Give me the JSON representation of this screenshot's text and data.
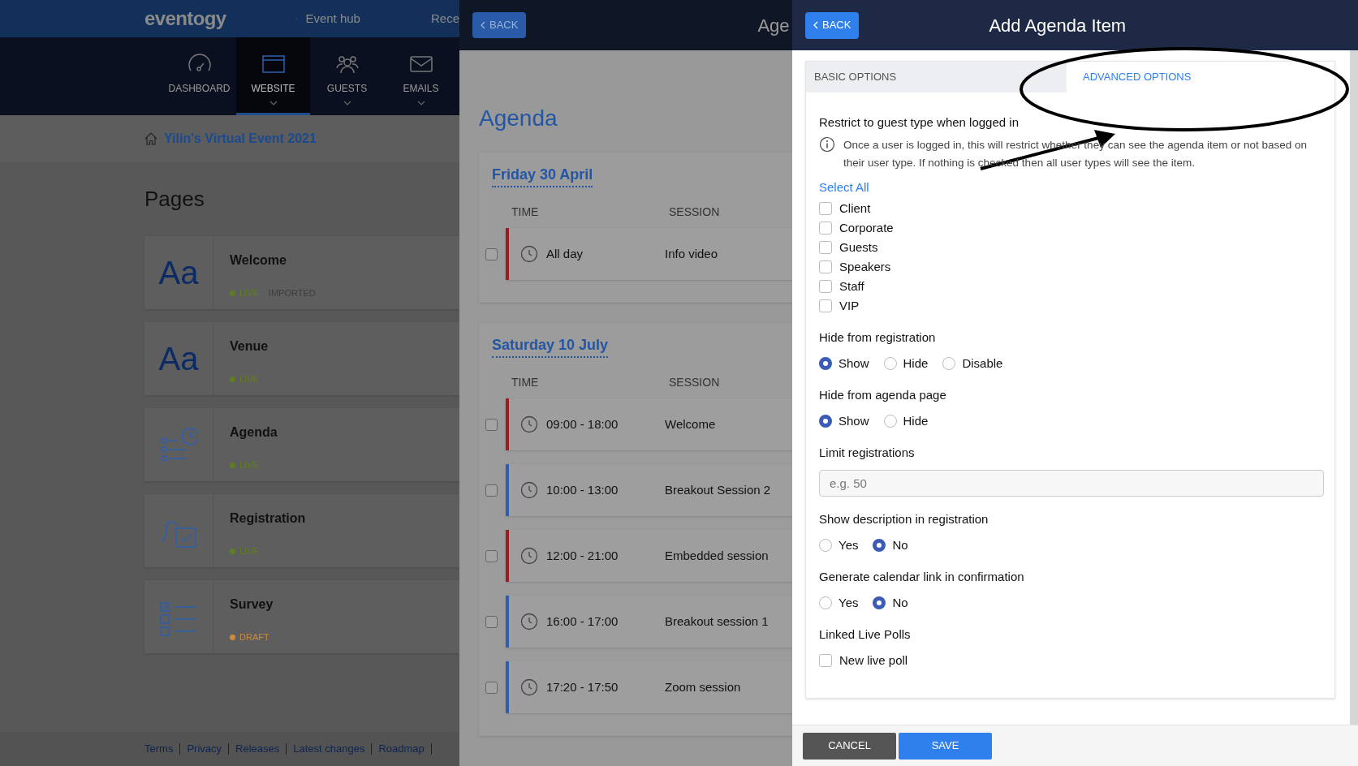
{
  "app_panel": {
    "logo": "eventogy",
    "back_link": "Event hub",
    "nav_cut": "Rece",
    "nav": [
      {
        "label": "DASHBOARD",
        "selected": false,
        "caret": false
      },
      {
        "label": "WEBSITE",
        "selected": true,
        "caret": true
      },
      {
        "label": "GUESTS",
        "selected": false,
        "caret": true
      },
      {
        "label": "EMAILS",
        "selected": false,
        "caret": true
      }
    ],
    "breadcrumb": "Yilin's Virtual Event 2021",
    "title": "Pages",
    "pages": [
      {
        "name": "Welcome",
        "kind": "text",
        "icon_text": "Aa",
        "statuses": [
          {
            "label": "LIVE",
            "color": "#5f7f1f"
          },
          {
            "label": "IMPORTED"
          }
        ]
      },
      {
        "name": "Venue",
        "kind": "text",
        "icon_text": "Aa",
        "statuses": [
          {
            "label": "LIVE",
            "color": "#5f7f1f"
          }
        ]
      },
      {
        "name": "Agenda",
        "kind": "agenda",
        "statuses": [
          {
            "label": "LIVE",
            "color": "#5f7f1f"
          }
        ]
      },
      {
        "name": "Registration",
        "kind": "registration",
        "statuses": [
          {
            "label": "LIVE",
            "color": "#5f7f1f"
          }
        ]
      },
      {
        "name": "Survey",
        "kind": "survey",
        "statuses": [
          {
            "label": "DRAFT",
            "color": "#d08a3a"
          }
        ]
      }
    ],
    "footer_links": [
      "Terms",
      "Privacy",
      "Releases",
      "Latest changes",
      "Roadmap"
    ]
  },
  "agenda_panel": {
    "back": "BACK",
    "header_title": "Age",
    "title": "Agenda",
    "days": [
      {
        "date": "Friday 30 April",
        "columns": [
          "TIME",
          "SESSION"
        ],
        "rows": [
          {
            "time": "All day",
            "session": "Info video",
            "checked": false,
            "color": "#9b1b22"
          }
        ]
      },
      {
        "date": "Saturday 10 July",
        "columns": [
          "TIME",
          "SESSION"
        ],
        "rows": [
          {
            "time": "09:00 - 18:00",
            "session": "Welcome",
            "checked": false,
            "color": "#9b1b22"
          },
          {
            "time": "10:00 - 13:00",
            "session": "Breakout Session 2",
            "checked": false,
            "color": "#2d5fae"
          },
          {
            "time": "12:00 - 21:00",
            "session": "Embedded session",
            "checked": false,
            "color": "#9b1b22"
          },
          {
            "time": "16:00 - 17:00",
            "session": "Breakout session 1",
            "checked": false,
            "color": "#2d5fae"
          },
          {
            "time": "17:20 - 17:50",
            "session": "Zoom session",
            "checked": false,
            "color": "#2d5fae"
          }
        ]
      }
    ]
  },
  "editor": {
    "back": "BACK",
    "title": "Add Agenda Item",
    "tabs": [
      {
        "label": "BASIC OPTIONS",
        "selected": false
      },
      {
        "label": "ADVANCED OPTIONS",
        "selected": true
      }
    ],
    "sections": [
      {
        "kind": "checkboxes",
        "heading": "Restrict to guest type when logged in",
        "info": "Once a user is logged in, this will restrict whether they can see the agenda item or not based on their user type. If nothing is checked then all user types will see the item.",
        "select_all": "Select All",
        "options": [
          {
            "label": "Client",
            "checked": false
          },
          {
            "label": "Corporate",
            "checked": false
          },
          {
            "label": "Guests",
            "checked": false
          },
          {
            "label": "Speakers",
            "checked": false
          },
          {
            "label": "Staff",
            "checked": false
          },
          {
            "label": "VIP",
            "checked": false
          }
        ]
      },
      {
        "kind": "radios",
        "heading": "Hide from registration",
        "options": [
          {
            "label": "Show",
            "selected": true
          },
          {
            "label": "Hide",
            "selected": false
          },
          {
            "label": "Disable",
            "selected": false
          }
        ]
      },
      {
        "kind": "radios",
        "heading": "Hide from agenda page",
        "options": [
          {
            "label": "Show",
            "selected": true
          },
          {
            "label": "Hide",
            "selected": false
          }
        ]
      },
      {
        "kind": "input",
        "heading": "Limit registrations",
        "placeholder": "e.g. 50"
      },
      {
        "kind": "radios",
        "heading": "Show description in registration",
        "options": [
          {
            "label": "Yes",
            "selected": false
          },
          {
            "label": "No",
            "selected": true
          }
        ]
      },
      {
        "kind": "radios",
        "heading": "Generate calendar link in confirmation",
        "options": [
          {
            "label": "Yes",
            "selected": false
          },
          {
            "label": "No",
            "selected": true
          }
        ]
      },
      {
        "kind": "checkboxes",
        "heading": "Linked Live Polls",
        "options": [
          {
            "label": "New live poll",
            "checked": false
          }
        ]
      }
    ],
    "buttons": [
      {
        "label": "CANCEL",
        "kind": "secondary"
      },
      {
        "label": "SAVE",
        "kind": "primary"
      }
    ]
  }
}
